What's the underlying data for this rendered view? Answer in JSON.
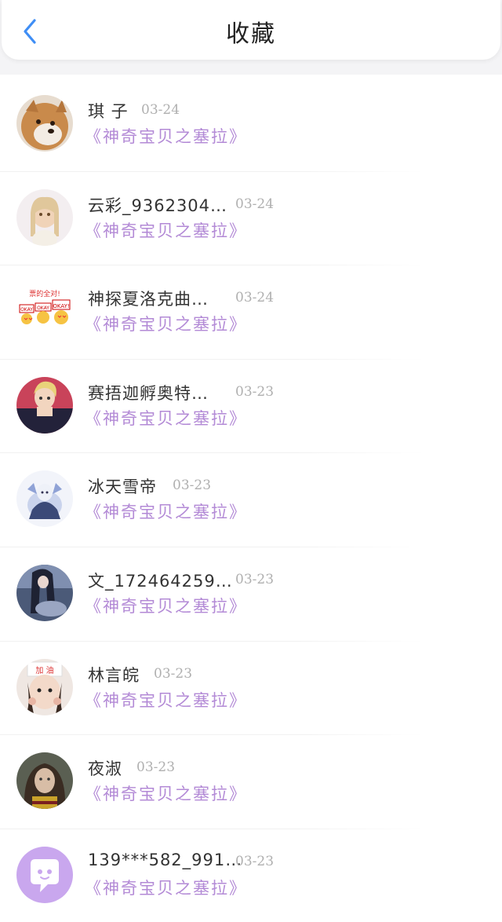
{
  "header": {
    "title": "收藏",
    "back_icon": "chevron-left-icon",
    "accent": "#3f8ef5"
  },
  "favorites": [
    {
      "name": "琪 子",
      "date": "03-24",
      "work": "《神奇宝贝之塞拉》",
      "avatar": "shiba-dog"
    },
    {
      "name": "云彩_9362304…",
      "date": "03-24",
      "work": "《神奇宝贝之塞拉》",
      "avatar": "anime-girl"
    },
    {
      "name": "神探夏洛克曲…",
      "date": "03-24",
      "work": "《神奇宝贝之塞拉》",
      "avatar": "okay-stickers"
    },
    {
      "name": "赛捂迦孵奥特…",
      "date": "03-23",
      "work": "《神奇宝贝之塞拉》",
      "avatar": "anime-boy"
    },
    {
      "name": "冰天雪帝",
      "date": "03-23",
      "work": "《神奇宝贝之塞拉》",
      "avatar": "ice-character"
    },
    {
      "name": "文_172464259…",
      "date": "03-23",
      "work": "《神奇宝贝之塞拉》",
      "avatar": "dark-anime"
    },
    {
      "name": "林言皖",
      "date": "03-23",
      "work": "《神奇宝贝之塞拉》",
      "avatar": "girl-photo"
    },
    {
      "name": "夜淑",
      "date": "03-23",
      "work": "《神奇宝贝之塞拉》",
      "avatar": "portrait"
    },
    {
      "name": "139***582_991…",
      "date": "03-23",
      "work": "《神奇宝贝之塞拉》",
      "avatar": "default-chat"
    }
  ],
  "colors": {
    "work_link": "#b38ad6",
    "date": "#b0b0b0",
    "default_avatar": "#c9a7ee"
  }
}
